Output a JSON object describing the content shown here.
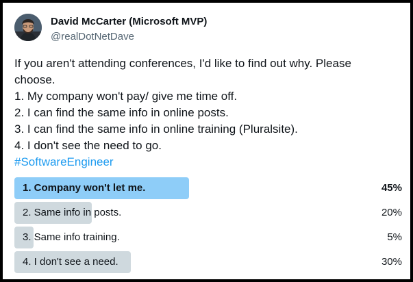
{
  "author": {
    "name": "David McCarter (Microsoft MVP)",
    "handle": "@realDotNetDave",
    "avatar_icon": "profile-photo"
  },
  "tweet": {
    "lines": [
      "If you aren't attending conferences, I'd like to find out why. Please",
      "choose.",
      "1. My company won't pay/ give me time off.",
      "2. I can find the same info in online posts.",
      "3. I can find the same info in online training (Pluralsite).",
      "4. I don't see the need to go."
    ],
    "hashtag": "#SoftwareEngineer"
  },
  "poll": {
    "options": [
      {
        "label": "1. Company won't let me.",
        "percent": "45%",
        "fraction": 0.45,
        "winner": true
      },
      {
        "label": "2. Same info in posts.",
        "percent": "20%",
        "fraction": 0.2,
        "winner": false
      },
      {
        "label": "3. Same info training.",
        "percent": "5%",
        "fraction": 0.05,
        "winner": false
      },
      {
        "label": "4. I don't see a need.",
        "percent": "30%",
        "fraction": 0.3,
        "winner": false
      }
    ],
    "colors": {
      "winner": "#8ecdf8",
      "other": "#cfd9de"
    }
  },
  "colors": {
    "hashtag": "#1d9bf0",
    "handle": "#536471",
    "text": "#0f1419"
  }
}
